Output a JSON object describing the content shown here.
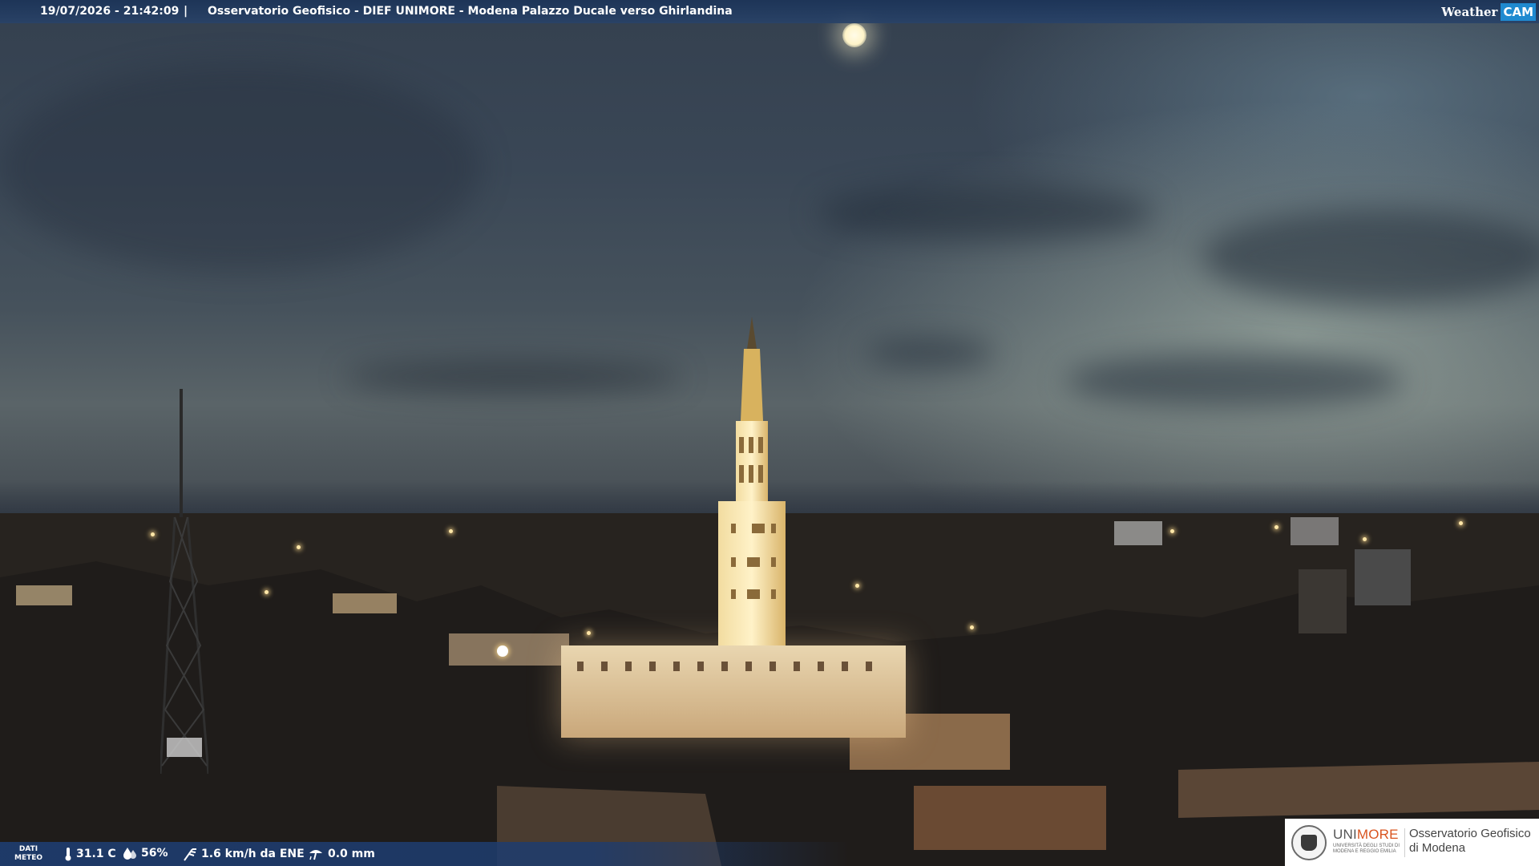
{
  "header": {
    "datetime": "19/07/2026 - 21:42:09",
    "separator": "|",
    "title": "Osservatorio Geofisico - DIEF UNIMORE - Modena Palazzo Ducale verso Ghirlandina",
    "brand_weather": "Weather",
    "brand_cam": "CAM",
    "bar_color": "#284268"
  },
  "meteo": {
    "label_line1": "DATI",
    "label_line2": "METEO",
    "temperature": "31.1 C",
    "humidity": "56%",
    "wind": "1.6 km/h da ENE",
    "rain": "0.0 mm",
    "icons": [
      "thermometer-icon",
      "humidity-drop-icon",
      "wind-icon",
      "rain-icon"
    ]
  },
  "logo": {
    "uni_prefix": "UNI",
    "uni_suffix": "MORE",
    "uni_subtitle": "UNIVERSITÀ DEGLI STUDI DI MODENA E REGGIO EMILIA",
    "observatory_line1": "Osservatorio Geofisico",
    "observatory_line2": "di Modena",
    "accent_color": "#d9541f"
  }
}
